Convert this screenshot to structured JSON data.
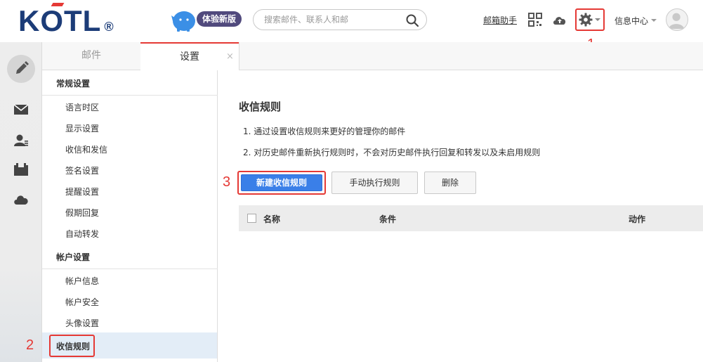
{
  "brand": {
    "logo_text": "KOTL",
    "trademark": "®"
  },
  "header": {
    "experience_badge": "体验新版",
    "search_placeholder": "搜索邮件、联系人和邮",
    "mail_helper": "邮箱助手",
    "info_center": "信息中心"
  },
  "tabs": [
    {
      "label": "邮件"
    },
    {
      "label": "设置",
      "close": "×"
    }
  ],
  "settings_nav": {
    "general_title": "常规设置",
    "general_items": [
      "语言时区",
      "显示设置",
      "收信和发信",
      "签名设置",
      "提醒设置",
      "假期回复",
      "自动转发"
    ],
    "account_title": "帐户设置",
    "account_items": [
      "帐户信息",
      "帐户安全",
      "头像设置"
    ],
    "active_item": "收信规则"
  },
  "content": {
    "title": "收信规则",
    "notes": [
      "1. 通过设置收信规则来更好的管理你的邮件",
      "2. 对历史邮件重新执行规则时，不会对历史邮件执行回复和转发以及未启用规则"
    ],
    "buttons": {
      "new_rule": "新建收信规则",
      "run_rules": "手动执行规则",
      "delete": "删除"
    },
    "table_headers": {
      "name": "名称",
      "condition": "条件",
      "action": "动作"
    }
  },
  "annotations": [
    "1",
    "2",
    "3"
  ],
  "colors": {
    "highlight": "#e53935",
    "primary": "#3a7fe8",
    "active_nav_bg": "#e3edf7"
  },
  "icons": [
    "compose-icon",
    "mail-icon",
    "contacts-icon",
    "calendar-icon",
    "cloud-icon",
    "qr-code-icon",
    "gear-icon",
    "search-icon",
    "avatar-icon"
  ]
}
